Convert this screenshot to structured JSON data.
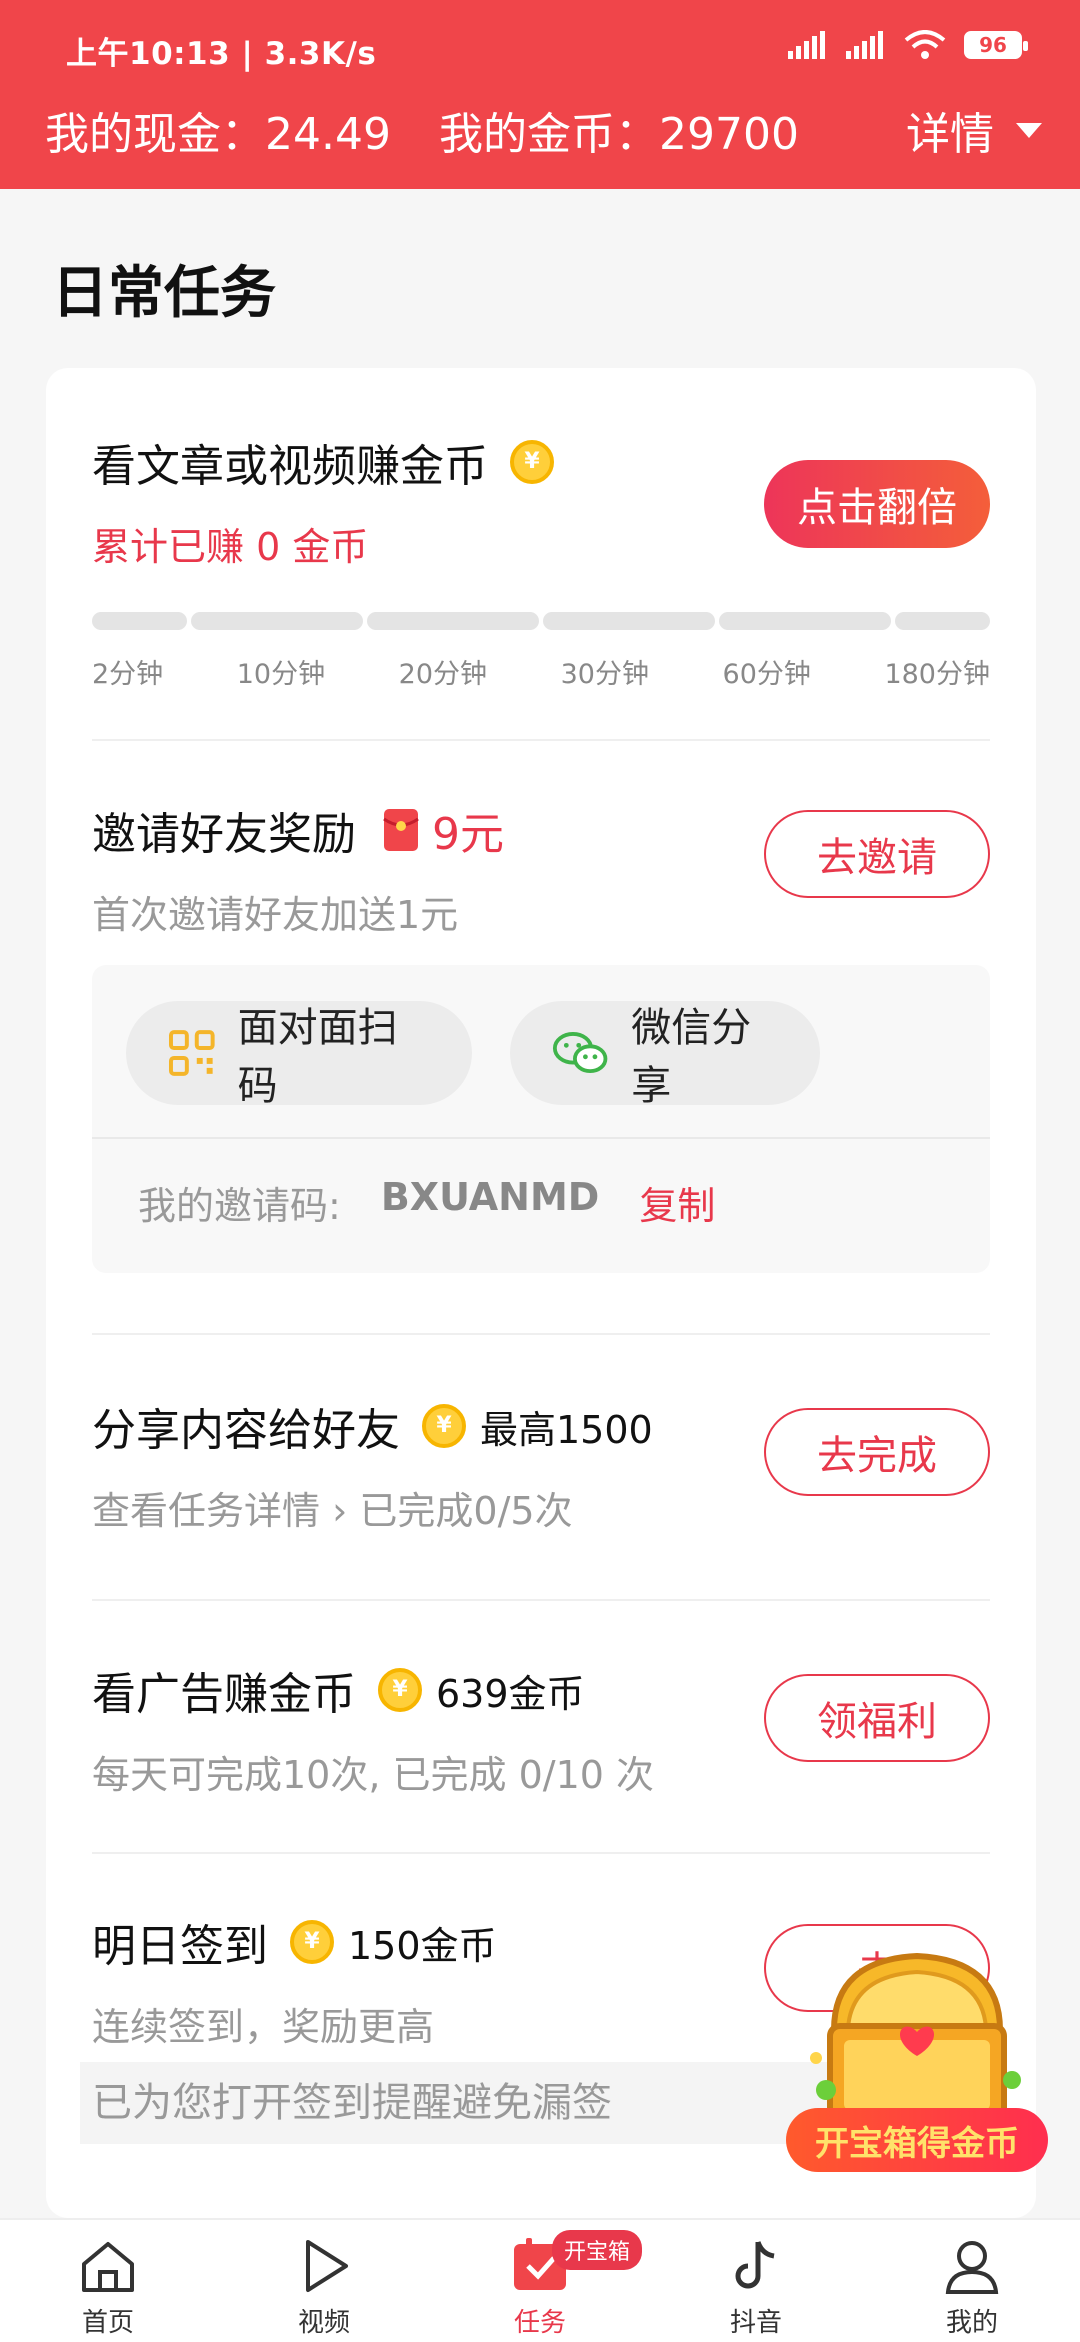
{
  "status_bar": {
    "time": "上午10:13 | 3.3K/s",
    "battery": "96"
  },
  "header": {
    "cash": "我的现金：24.49",
    "coins": "我的金币：29700",
    "detail": "详情"
  },
  "section_title": "日常任务",
  "tasks": {
    "read": {
      "title": "看文章或视频赚金币",
      "sub": "累计已赚 0 金币",
      "button": "点击翻倍",
      "ticks": [
        "2分钟",
        "10分钟",
        "20分钟",
        "30分钟",
        "60分钟",
        "180分钟"
      ]
    },
    "invite": {
      "title": "邀请好友奖励",
      "reward": "9元",
      "sub": "首次邀请好友加送1元",
      "button": "去邀请",
      "scan": "面对面扫码",
      "wechat": "微信分享",
      "code_label": "我的邀请码:",
      "code": "BXUANMD",
      "copy": "复制"
    },
    "share": {
      "title": "分享内容给好友",
      "reward": "最高1500",
      "sub_link": "查看任务详情",
      "sub": "已完成0/5次",
      "button": "去完成"
    },
    "ads": {
      "title": "看广告赚金币",
      "reward": "639金币",
      "sub": "每天可完成10次, 已完成 0/10 次",
      "button": "领福利"
    },
    "signin": {
      "title": "明日签到",
      "reward": "150金币",
      "sub": "连续签到，奖励更高",
      "button": "去",
      "remind": "已为您打开签到提醒避免漏签"
    }
  },
  "chest": {
    "label": "开宝箱得金币"
  },
  "tabbar": {
    "home": "首页",
    "video": "视频",
    "task": "任务",
    "task_badge": "开宝箱",
    "douyin": "抖音",
    "mine": "我的"
  },
  "colors": {
    "brand": "#f0454a",
    "accent": "#e8384b"
  }
}
